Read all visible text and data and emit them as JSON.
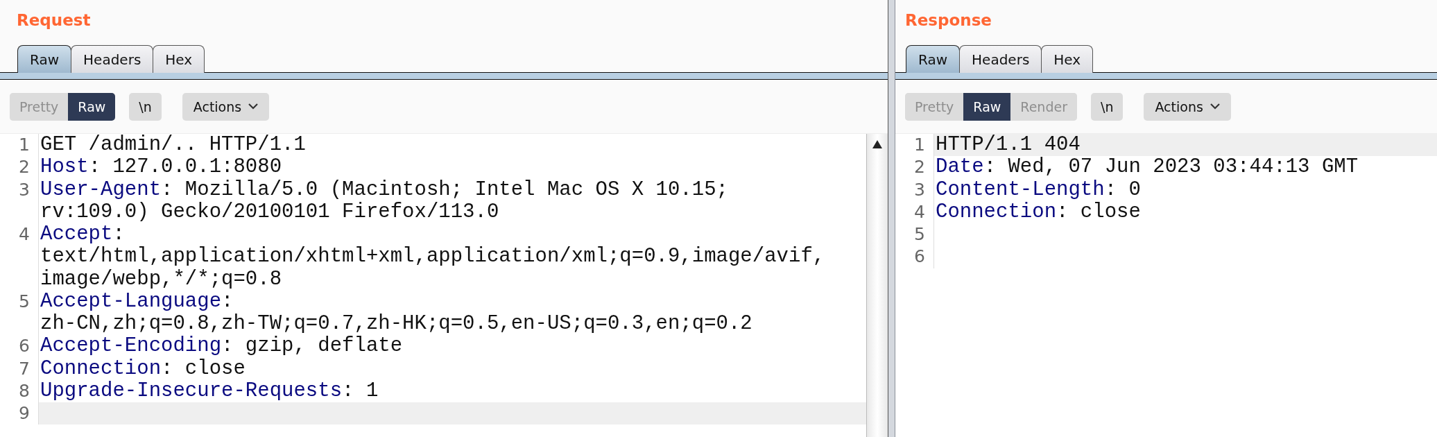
{
  "panels": [
    {
      "title": "Request",
      "tabs": [
        {
          "label": "Raw",
          "selected": true
        },
        {
          "label": "Headers",
          "selected": false
        },
        {
          "label": "Hex",
          "selected": false
        }
      ],
      "views": [
        {
          "label": "Pretty",
          "selected": false
        },
        {
          "label": "Raw",
          "selected": true
        }
      ],
      "newline_button": "\\n",
      "actions_button": "Actions",
      "scrollbar": true,
      "lines": [
        {
          "number": "1",
          "text": "GET /admin/.. HTTP/1.1",
          "current": false
        },
        {
          "number": "2",
          "key": "Host",
          "value": ": 127.0.0.1:8080",
          "current": false
        },
        {
          "number": "3",
          "key": "User-Agent",
          "value": ": Mozilla/5.0 (Macintosh; Intel Mac OS X 10.15;",
          "wrap": [
            "rv:109.0) Gecko/20100101 Firefox/113.0"
          ],
          "current": false
        },
        {
          "number": "4",
          "key": "Accept",
          "value": ":",
          "wrap": [
            "text/html,application/xhtml+xml,application/xml;q=0.9,image/avif,",
            "image/webp,*/*;q=0.8"
          ],
          "current": false
        },
        {
          "number": "5",
          "key": "Accept-Language",
          "value": ":",
          "wrap": [
            "zh-CN,zh;q=0.8,zh-TW;q=0.7,zh-HK;q=0.5,en-US;q=0.3,en;q=0.2"
          ],
          "current": false
        },
        {
          "number": "6",
          "key": "Accept-Encoding",
          "value": ": gzip, deflate",
          "current": false
        },
        {
          "number": "7",
          "key": "Connection",
          "value": ": close",
          "current": false
        },
        {
          "number": "8",
          "key": "Upgrade-Insecure-Requests",
          "value": ": 1",
          "current": false
        },
        {
          "number": "9",
          "current": true
        }
      ]
    },
    {
      "title": "Response",
      "tabs": [
        {
          "label": "Raw",
          "selected": true
        },
        {
          "label": "Headers",
          "selected": false
        },
        {
          "label": "Hex",
          "selected": false
        }
      ],
      "views": [
        {
          "label": "Pretty",
          "selected": false
        },
        {
          "label": "Raw",
          "selected": true
        },
        {
          "label": "Render",
          "selected": false
        }
      ],
      "newline_button": "\\n",
      "actions_button": "Actions",
      "scrollbar": false,
      "lines": [
        {
          "number": "1",
          "text": "HTTP/1.1 404",
          "current": true
        },
        {
          "number": "2",
          "key": "Date",
          "value": ": Wed, 07 Jun 2023 03:44:13 GMT",
          "current": false
        },
        {
          "number": "3",
          "key": "Content-Length",
          "value": ": 0",
          "current": false
        },
        {
          "number": "4",
          "key": "Connection",
          "value": ": close",
          "current": false
        },
        {
          "number": "5",
          "current": false
        },
        {
          "number": "6",
          "current": false
        }
      ]
    }
  ]
}
